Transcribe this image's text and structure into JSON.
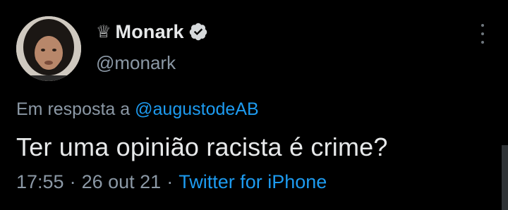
{
  "tweet": {
    "crown_icon": "crown-icon",
    "display_name": "Monark",
    "verified_icon": "verified-badge-icon",
    "handle": "@monark",
    "reply_prefix": "Em resposta a",
    "reply_mention": "@augustodeAB",
    "text": "Ter uma opinião racista é crime?",
    "time": "17:55",
    "separator": "·",
    "date": "26 out 21",
    "source": "Twitter for iPhone"
  },
  "colors": {
    "background": "#000000",
    "primary_text": "#e7e9ea",
    "secondary_text": "#8b98a5",
    "accent": "#1d9bf0"
  }
}
